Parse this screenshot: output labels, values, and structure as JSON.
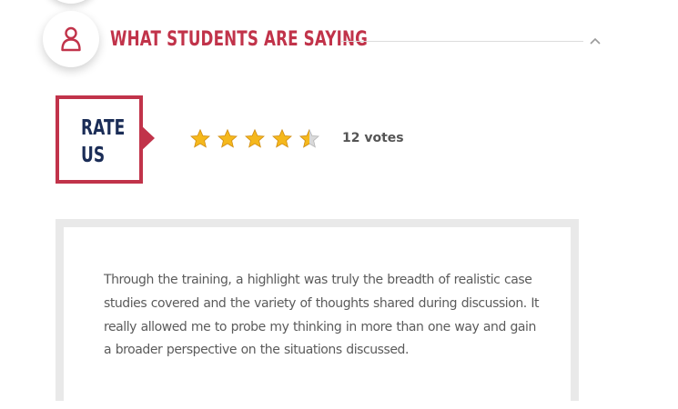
{
  "section": {
    "title": "WHAT STUDENTS ARE SAYING",
    "icon": "person-icon",
    "toggle_icon": "chevron-up-icon",
    "accent_color": "#c1334a"
  },
  "rating": {
    "label_line1": "RATE",
    "label_line2": "US",
    "stars_filled": 4.5,
    "stars_total": 5,
    "votes_text": "12 votes",
    "star_color": "#f5b81c",
    "label_color": "#1b2d57"
  },
  "testimonial": {
    "text": "Through the training, a highlight was truly the breadth of realistic case studies covered and the variety of thoughts shared during discussion. It really allowed me to probe my thinking in more than one way and gain a broader perspective on the situations discussed."
  }
}
